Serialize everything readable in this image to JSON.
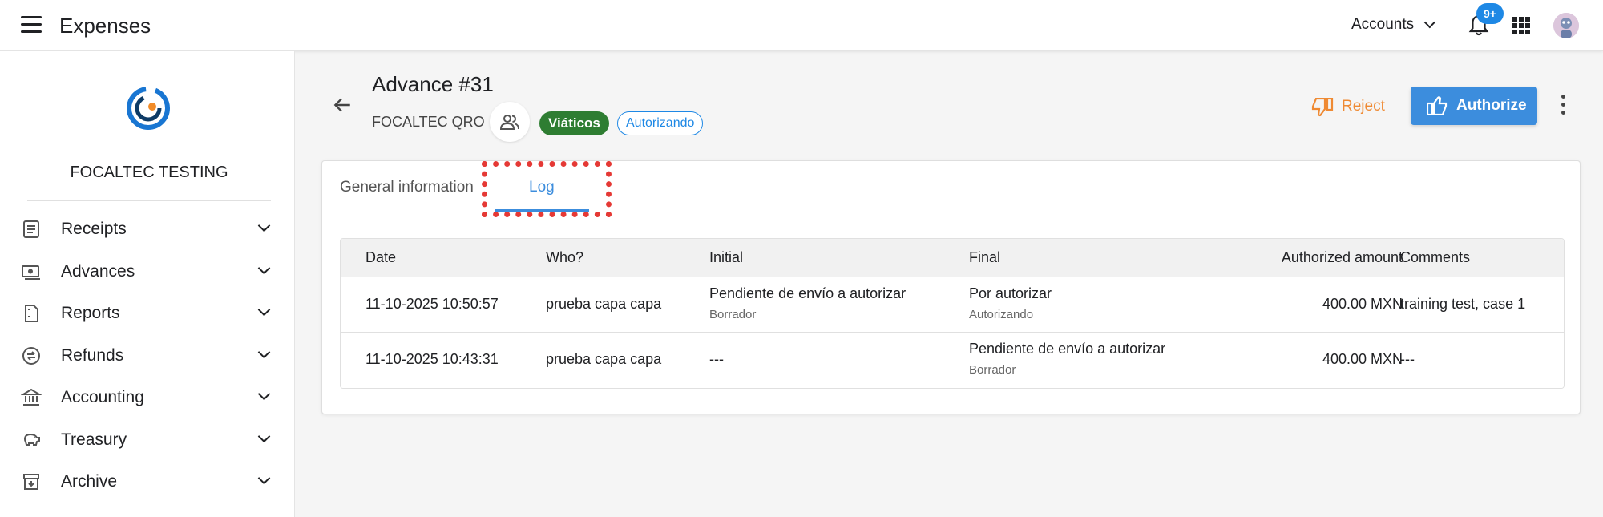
{
  "app": {
    "title": "Expenses"
  },
  "topbar": {
    "accounts_label": "Accounts",
    "notification_count": "9+"
  },
  "sidebar": {
    "org_name": "FOCALTEC TESTING",
    "items": [
      {
        "label": "Receipts",
        "icon": "receipt-icon"
      },
      {
        "label": "Advances",
        "icon": "cash-icon"
      },
      {
        "label": "Reports",
        "icon": "report-icon"
      },
      {
        "label": "Refunds",
        "icon": "refund-icon"
      },
      {
        "label": "Accounting",
        "icon": "bank-icon"
      },
      {
        "label": "Treasury",
        "icon": "piggy-bank-icon"
      },
      {
        "label": "Archive",
        "icon": "archive-icon"
      }
    ]
  },
  "header": {
    "title": "Advance #31",
    "company": "FOCALTEC QRO",
    "chip_type": "Viáticos",
    "chip_status": "Autorizando",
    "reject_label": "Reject",
    "authorize_label": "Authorize"
  },
  "tabs": {
    "general": "General information",
    "log": "Log"
  },
  "table": {
    "headers": [
      "Date",
      "Who?",
      "Initial",
      "Final",
      "Authorized amount",
      "Comments"
    ],
    "rows": [
      {
        "date": "11-10-2025 10:50:57",
        "who": "prueba capa capa",
        "initial": "Pendiente de envío a autorizar",
        "initial_sub": "Borrador",
        "final": "Por autorizar",
        "final_sub": "Autorizando",
        "amount": "400.00 MXN",
        "comments": "training test, case 1"
      },
      {
        "date": "11-10-2025 10:43:31",
        "who": "prueba capa capa",
        "initial": "---",
        "initial_sub": "",
        "final": "Pendiente de envío a autorizar",
        "final_sub": "Borrador",
        "amount": "400.00 MXN",
        "comments": "---"
      }
    ]
  },
  "colors": {
    "accent": "#3c8ddd",
    "reject": "#ef8a33",
    "chip_green": "#2e7d32",
    "highlight": "#e53935"
  }
}
